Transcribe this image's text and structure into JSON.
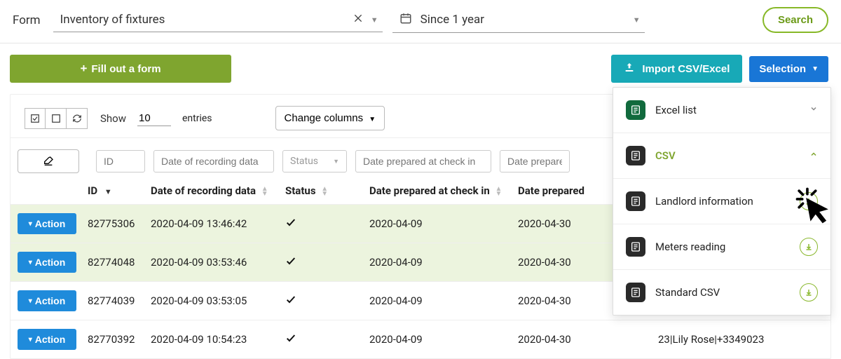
{
  "topbar": {
    "form_label": "Form",
    "form_value": "Inventory of fixtures",
    "time_value": "Since 1 year",
    "search_label": "Search"
  },
  "actionbar": {
    "fill_label": "Fill out a form",
    "import_label": "Import CSV/Excel",
    "selection_label": "Selection"
  },
  "dropdown": {
    "items": [
      {
        "label": "Excel list",
        "icon": "excel",
        "active": false,
        "expanded": false
      },
      {
        "label": "CSV",
        "icon": "dark",
        "active": true,
        "expanded": true
      },
      {
        "label": "Landlord information",
        "icon": "dark",
        "active": false,
        "download": true,
        "cursor": true
      },
      {
        "label": "Meters reading",
        "icon": "dark",
        "active": false,
        "download": true
      },
      {
        "label": "Standard CSV",
        "icon": "dark",
        "active": false,
        "download": true
      }
    ]
  },
  "controls": {
    "show_label": "Show",
    "show_value": "10",
    "entries_label": "entries",
    "change_columns_label": "Change columns"
  },
  "filters": {
    "id": "ID",
    "recording": "Date of recording data",
    "status": "Status",
    "checkin": "Date prepared at check in",
    "checkout": "Date prepare"
  },
  "headers": {
    "id": "ID",
    "recording": "Date of recording data",
    "status": "Status",
    "checkin": "Date prepared at check in",
    "checkout": "Date prepared"
  },
  "row_action_label": "Action",
  "rows": [
    {
      "id": "82775306",
      "recording": "2020-04-09 13:46:42",
      "status_check": true,
      "checkin": "2020-04-09",
      "checkout": "2020-04-30",
      "green": true,
      "extra": ""
    },
    {
      "id": "82774048",
      "recording": "2020-04-09 03:53:46",
      "status_check": true,
      "checkin": "2020-04-09",
      "checkout": "2020-04-30",
      "green": true,
      "extra": ""
    },
    {
      "id": "82774039",
      "recording": "2020-04-09 03:53:05",
      "status_check": true,
      "checkin": "2020-04-09",
      "checkout": "2020-04-30",
      "green": false,
      "extra": ""
    },
    {
      "id": "82770392",
      "recording": "2020-04-09 10:54:23",
      "status_check": true,
      "checkin": "2020-04-09",
      "checkout": "2020-04-30",
      "green": false,
      "extra": "23|Lily Rose|+3349023"
    }
  ]
}
